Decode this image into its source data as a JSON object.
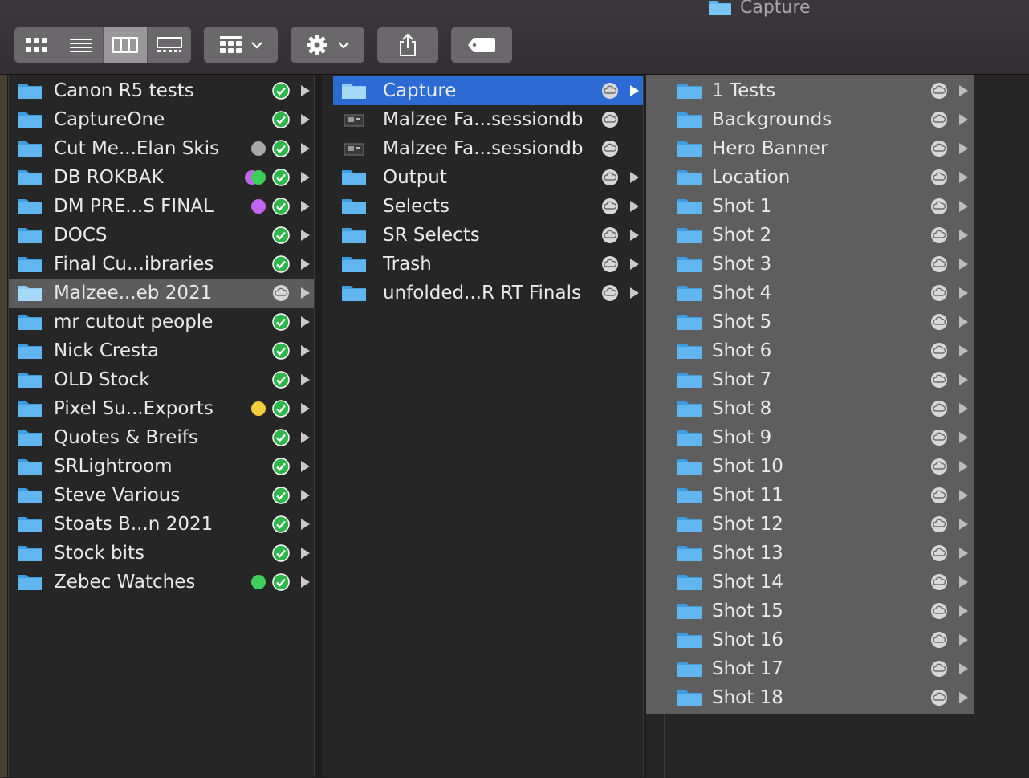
{
  "window": {
    "title": "Capture"
  },
  "toolbar": {
    "view_buttons": [
      "icon-view",
      "list-view",
      "column-view",
      "gallery-view"
    ],
    "active_view": "column-view"
  },
  "column1": {
    "items": [
      {
        "label": "Canon R5 tests",
        "tags": [],
        "status": "synced"
      },
      {
        "label": "CaptureOne",
        "tags": [],
        "status": "synced"
      },
      {
        "label": "Cut Me...Elan Skis",
        "tags": [
          "#a9a9a9"
        ],
        "status": "synced"
      },
      {
        "label": "DB ROKBAK",
        "tags": [
          "#c266f0",
          "#3ecf5a"
        ],
        "status": "synced"
      },
      {
        "label": "DM PRE...S FINAL",
        "tags": [
          "#c266f0"
        ],
        "status": "synced"
      },
      {
        "label": "DOCS",
        "tags": [],
        "status": "synced"
      },
      {
        "label": "Final Cu...ibraries",
        "tags": [],
        "status": "synced"
      },
      {
        "label": "Malzee...eb 2021",
        "tags": [],
        "status": "cloud",
        "selected": true
      },
      {
        "label": "mr cutout people",
        "tags": [],
        "status": "synced"
      },
      {
        "label": "Nick Cresta",
        "tags": [],
        "status": "synced"
      },
      {
        "label": "OLD Stock",
        "tags": [],
        "status": "synced"
      },
      {
        "label": "Pixel Su...Exports",
        "tags": [
          "#f2cf3a"
        ],
        "status": "synced"
      },
      {
        "label": "Quotes & Breifs",
        "tags": [],
        "status": "synced"
      },
      {
        "label": "SRLightroom",
        "tags": [],
        "status": "synced"
      },
      {
        "label": "Steve Various",
        "tags": [],
        "status": "synced"
      },
      {
        "label": "Stoats B...n 2021",
        "tags": [],
        "status": "synced"
      },
      {
        "label": "Stock bits",
        "tags": [],
        "status": "synced"
      },
      {
        "label": "Zebec Watches",
        "tags": [
          "#3ecf5a"
        ],
        "status": "synced"
      }
    ]
  },
  "column2": {
    "items": [
      {
        "label": "Capture",
        "kind": "folder",
        "selected": true,
        "chevron": true
      },
      {
        "label": "Malzee Fa...sessiondb",
        "kind": "file",
        "chevron": false
      },
      {
        "label": "Malzee Fa...sessiondb",
        "kind": "file",
        "chevron": false
      },
      {
        "label": "Output",
        "kind": "folder",
        "chevron": true
      },
      {
        "label": "Selects",
        "kind": "folder",
        "chevron": true
      },
      {
        "label": "SR Selects",
        "kind": "folder",
        "chevron": true
      },
      {
        "label": "Trash",
        "kind": "folder",
        "chevron": true
      },
      {
        "label": "unfolded...R RT Finals",
        "kind": "folder",
        "chevron": true
      }
    ]
  },
  "column3": {
    "items": [
      "1 Tests",
      "Backgrounds",
      "Hero Banner",
      "Location",
      "Shot 1",
      "Shot 2",
      "Shot 3",
      "Shot 4",
      "Shot 5",
      "Shot 6",
      "Shot 7",
      "Shot 8",
      "Shot 9",
      "Shot 10",
      "Shot 11",
      "Shot 12",
      "Shot 13",
      "Shot 14",
      "Shot 15",
      "Shot 16",
      "Shot 17",
      "Shot 18"
    ]
  },
  "colors": {
    "folder": "#5fb6f0",
    "check_green": "#2fb64a",
    "selection_blue": "#2d6bd4",
    "selection_gray": "#5c5c5c"
  }
}
